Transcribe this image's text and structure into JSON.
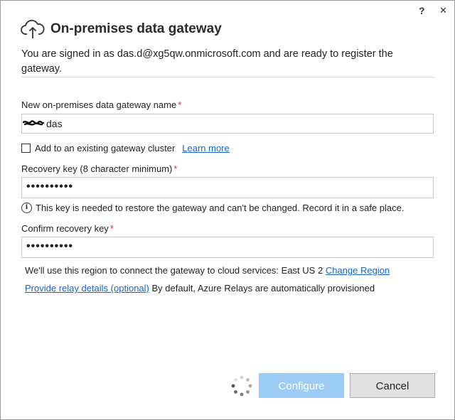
{
  "window": {
    "help_label": "?",
    "close_label": "✕"
  },
  "header": {
    "title": "On-premises data gateway",
    "icon": "cloud-upload-icon"
  },
  "signed_in_text": "You are signed in as das.d@xg5qw.onmicrosoft.com and are ready to register the gateway.",
  "gateway_name": {
    "label": "New on-premises data gateway name",
    "required_mark": "*",
    "value": "das"
  },
  "cluster": {
    "label": "Add to an existing gateway cluster",
    "checked": false,
    "learn_more": "Learn more"
  },
  "recovery_key": {
    "label": "Recovery key (8 character minimum)",
    "required_mark": "*",
    "value": "••••••••••"
  },
  "info": {
    "icon": "info-icon",
    "text": "This key is needed to restore the gateway and can't be changed. Record it in a safe place."
  },
  "confirm_key": {
    "label": "Confirm recovery key",
    "required_mark": "*",
    "value": "••••••••••"
  },
  "region": {
    "text": "We'll use this region to connect the gateway to cloud services: East US 2",
    "link": "Change Region"
  },
  "relay": {
    "link": "Provide relay details (optional)",
    "text": "By default, Azure Relays are automatically provisioned"
  },
  "buttons": {
    "configure": "Configure",
    "cancel": "Cancel"
  },
  "colors": {
    "accent": "#1a63c5",
    "configure_bg": "#9ccbf5",
    "required": "#d13438"
  }
}
